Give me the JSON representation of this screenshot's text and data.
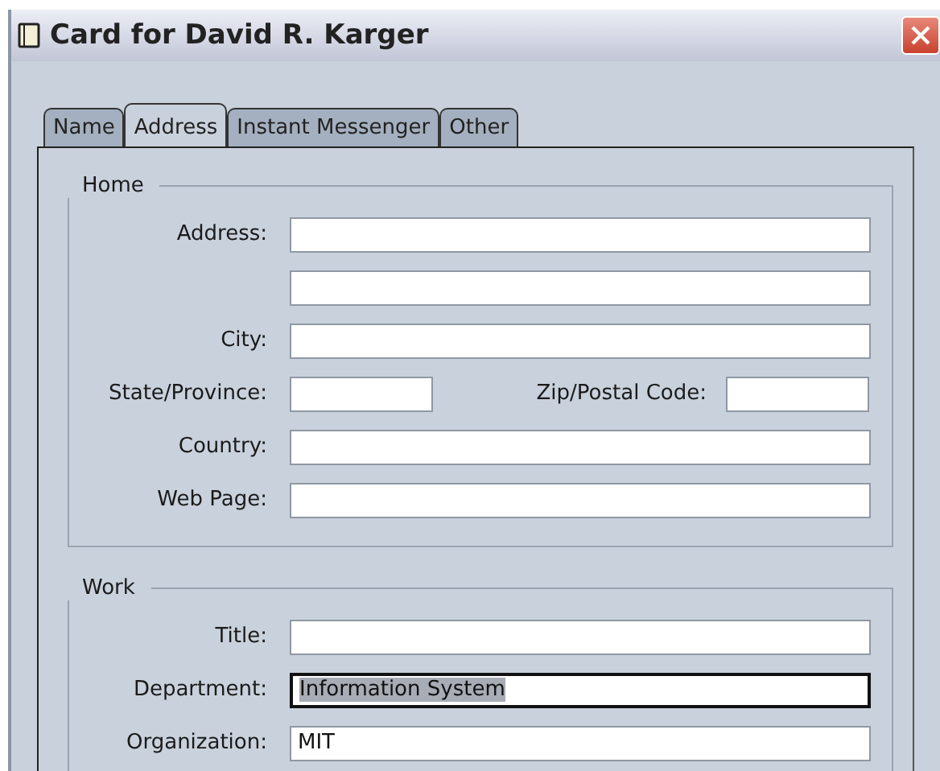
{
  "window": {
    "title": "Card for David R. Karger"
  },
  "tabs": [
    {
      "label": "Name",
      "selected": false
    },
    {
      "label": "Address",
      "selected": true
    },
    {
      "label": "Instant Messenger",
      "selected": false
    },
    {
      "label": "Other",
      "selected": false
    }
  ],
  "groups": [
    {
      "title": "Home",
      "rows": [
        {
          "kind": "wide",
          "label": "Address:",
          "value": "",
          "focused": false
        },
        {
          "kind": "wide",
          "label": "",
          "value": "",
          "focused": false
        },
        {
          "kind": "wide",
          "label": "City:",
          "value": "",
          "focused": false
        },
        {
          "kind": "pair",
          "label": "State/Province:",
          "value": "",
          "focused": false,
          "label2": "Zip/Postal Code:",
          "value2": ""
        },
        {
          "kind": "wide",
          "label": "Country:",
          "value": "",
          "focused": false
        },
        {
          "kind": "wide",
          "label": "Web Page:",
          "value": "",
          "focused": false
        }
      ]
    },
    {
      "title": "Work",
      "rows": [
        {
          "kind": "wide",
          "label": "Title:",
          "value": "",
          "focused": false
        },
        {
          "kind": "wide",
          "label": "Department:",
          "value": "Information System",
          "focused": true
        },
        {
          "kind": "wide",
          "label": "Organization:",
          "value": "MIT",
          "focused": false
        }
      ]
    }
  ]
}
